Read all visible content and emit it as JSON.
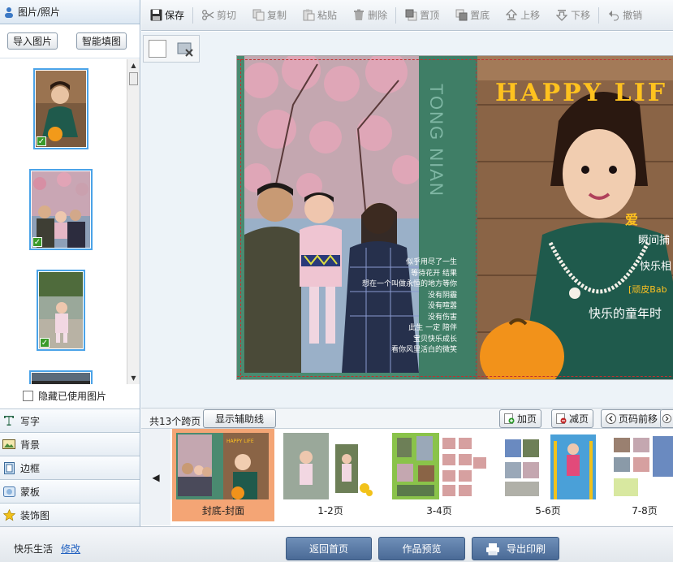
{
  "left_panel": {
    "header": "图片/照片",
    "import_button": "导入图片",
    "smart_fill_button": "智能填图",
    "hide_used_label": "隐藏已使用图片",
    "tools": [
      {
        "label": "写字",
        "icon": "text-icon"
      },
      {
        "label": "背景",
        "icon": "background-icon"
      },
      {
        "label": "边框",
        "icon": "frame-icon"
      },
      {
        "label": "蒙板",
        "icon": "mask-icon"
      },
      {
        "label": "装饰图",
        "icon": "star-icon"
      }
    ]
  },
  "toolbar": {
    "save": "保存",
    "cut": "剪切",
    "copy": "复制",
    "paste": "粘贴",
    "delete": "删除",
    "bring_top": "置顶",
    "send_bottom": "置底",
    "move_up": "上移",
    "move_down": "下移",
    "undo": "撤销"
  },
  "canvas": {
    "side_text": "TONG NIAN",
    "poem": [
      "似乎用尽了一生",
      "等待花开    结果",
      "想在一个叫做永恒的地方等你",
      "没有阴霾",
      "没有喧嚣",
      "没有伤害",
      "此生    一定    陪伴",
      "宝贝快乐成长",
      "看你风里活白的微笑"
    ],
    "front_title": "HAPPY LIF",
    "front_texts": [
      "爱",
      "瞬间捕",
      "快乐相",
      "[顽皮Bab",
      "快乐的童年时"
    ]
  },
  "strip_bar": {
    "page_count": "共13个跨页",
    "show_guides": "显示辅助线",
    "add_page": "加页",
    "remove_page": "减页",
    "page_prev": "页码前移"
  },
  "pages": [
    {
      "label": "封底-封面",
      "selected": true
    },
    {
      "label": "1-2页",
      "selected": false
    },
    {
      "label": "3-4页",
      "selected": false
    },
    {
      "label": "5-6页",
      "selected": false
    },
    {
      "label": "7-8页",
      "selected": false
    }
  ],
  "bottom": {
    "user_name": "快乐生活",
    "modify_link": "修改",
    "home_button": "返回首页",
    "preview_button": "作品预览",
    "export_button": "导出印刷"
  },
  "colors": {
    "cover_green": "#4a8a70",
    "title_yellow": "#ffc21f",
    "selected_page": "#f4a575",
    "bottom_button": "#5a7aa6"
  }
}
